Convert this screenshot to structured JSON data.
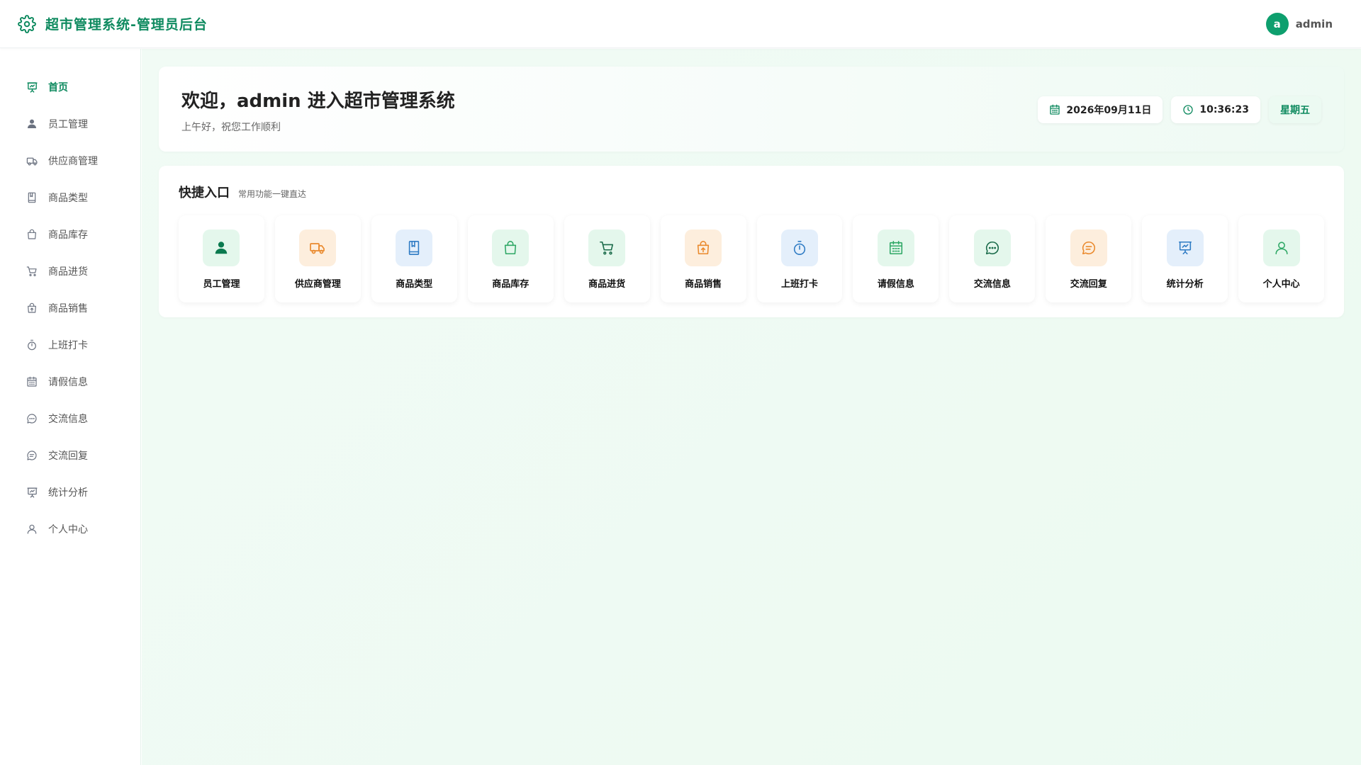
{
  "header": {
    "title": "超市管理系统-管理员后台",
    "brand_icon": "gear-icon",
    "user": {
      "avatar_letter": "a",
      "name": "admin"
    }
  },
  "sidebar": {
    "items": [
      {
        "label": "首页",
        "icon": "presentation-chart-icon",
        "active": true
      },
      {
        "label": "员工管理",
        "icon": "user-icon"
      },
      {
        "label": "供应商管理",
        "icon": "truck-icon"
      },
      {
        "label": "商品类型",
        "icon": "book-icon"
      },
      {
        "label": "商品库存",
        "icon": "bag-icon"
      },
      {
        "label": "商品进货",
        "icon": "cart-icon"
      },
      {
        "label": "商品销售",
        "icon": "bag-arrow-icon"
      },
      {
        "label": "上班打卡",
        "icon": "stopwatch-icon"
      },
      {
        "label": "请假信息",
        "icon": "calendar-icon"
      },
      {
        "label": "交流信息",
        "icon": "chat-dots-icon"
      },
      {
        "label": "交流回复",
        "icon": "chat-lines-icon"
      },
      {
        "label": "统计分析",
        "icon": "presentation-chart-icon"
      },
      {
        "label": "个人中心",
        "icon": "user-outline-icon"
      }
    ]
  },
  "welcome": {
    "title": "欢迎，admin 进入超市管理系统",
    "subtitle": "上午好，祝您工作顺利",
    "date": "2026年09月11日",
    "time": "10:36:23",
    "weekday": "星期五"
  },
  "quick": {
    "title": "快捷入口",
    "subtitle": "常用功能一键直达",
    "items": [
      {
        "label": "员工管理",
        "icon": "user-icon"
      },
      {
        "label": "供应商管理",
        "icon": "truck-icon"
      },
      {
        "label": "商品类型",
        "icon": "book-icon"
      },
      {
        "label": "商品库存",
        "icon": "bag-icon"
      },
      {
        "label": "商品进货",
        "icon": "cart-icon"
      },
      {
        "label": "商品销售",
        "icon": "bag-arrow-icon"
      },
      {
        "label": "上班打卡",
        "icon": "stopwatch-icon"
      },
      {
        "label": "请假信息",
        "icon": "calendar-icon"
      },
      {
        "label": "交流信息",
        "icon": "chat-dots-icon"
      },
      {
        "label": "交流回复",
        "icon": "chat-lines-icon"
      },
      {
        "label": "统计分析",
        "icon": "presentation-chart-icon"
      },
      {
        "label": "个人中心",
        "icon": "user-outline-icon"
      }
    ]
  },
  "colors": {
    "brand": "#0e8a5f",
    "avatar": "#0e9f6e",
    "main_bg": "#eefaf2"
  }
}
